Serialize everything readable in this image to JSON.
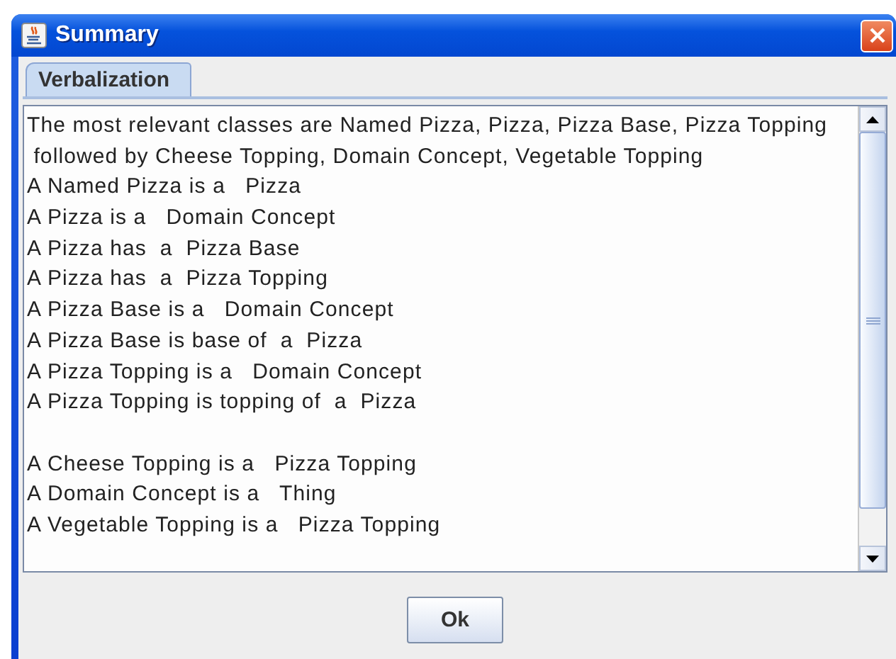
{
  "window": {
    "title": "Summary"
  },
  "tabs": [
    {
      "label": "Verbalization",
      "selected": true
    }
  ],
  "paragraphs": [
    [
      "The most relevant classes are Named Pizza, Pizza, Pizza Base, Pizza Topping",
      " followed by Cheese Topping, Domain Concept, Vegetable Topping",
      "A Named Pizza is a   Pizza",
      "A Pizza is a   Domain Concept",
      "A Pizza has  a  Pizza Base",
      "A Pizza has  a  Pizza Topping",
      "A Pizza Base is a   Domain Concept",
      "A Pizza Base is base of  a  Pizza",
      "A Pizza Topping is a   Domain Concept",
      "A Pizza Topping is topping of  a  Pizza"
    ],
    [
      "A Cheese Topping is a   Pizza Topping",
      "A Domain Concept is a   Thing",
      "A Vegetable Topping is a   Pizza Topping"
    ]
  ],
  "buttons": [
    "Ok"
  ]
}
